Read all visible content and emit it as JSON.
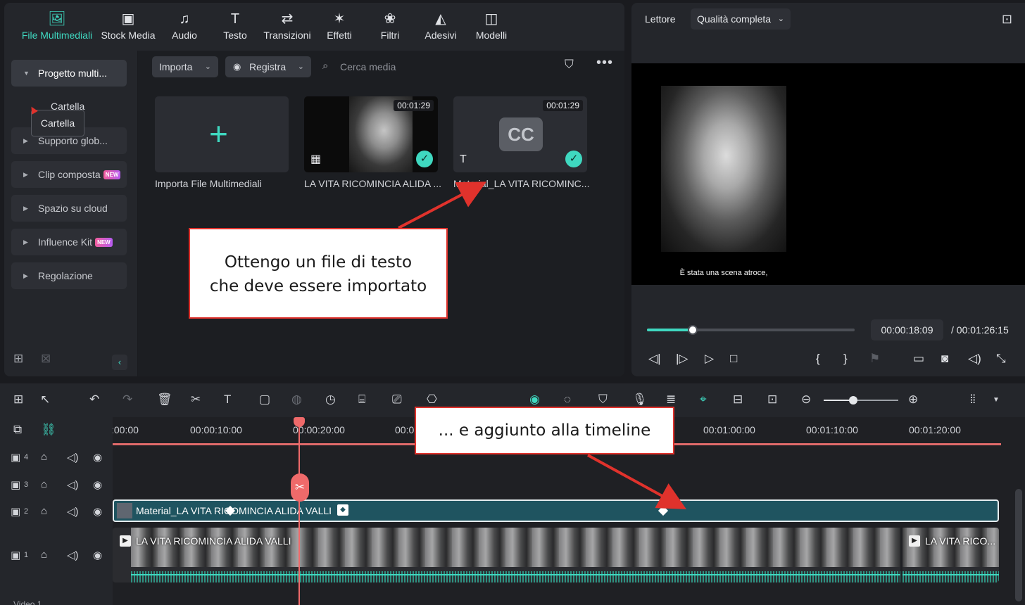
{
  "media_tabs": [
    {
      "label": "File Multimediali",
      "icon": "media-files-icon",
      "active": true
    },
    {
      "label": "Stock Media",
      "icon": "stock-media-icon"
    },
    {
      "label": "Audio",
      "icon": "music-note-icon"
    },
    {
      "label": "Testo",
      "icon": "text-t-icon"
    },
    {
      "label": "Transizioni",
      "icon": "transitions-icon"
    },
    {
      "label": "Effetti",
      "icon": "effects-sparkle-icon"
    },
    {
      "label": "Filtri",
      "icon": "filters-icon"
    },
    {
      "label": "Adesivi",
      "icon": "stickers-icon"
    },
    {
      "label": "Modelli",
      "icon": "templates-icon"
    }
  ],
  "sidebar": {
    "items": [
      {
        "label": "Progetto multi...",
        "open": true
      },
      {
        "label": "Supporto glob..."
      },
      {
        "label": "Clip composta",
        "badge": "NEW"
      },
      {
        "label": "Spazio su cloud"
      },
      {
        "label": "Influence Kit",
        "badge": "NEW"
      },
      {
        "label": "Regolazione"
      }
    ],
    "folder_label": "Cartella",
    "tooltip": "Cartella"
  },
  "media_toolbar": {
    "import_label": "Importa",
    "record_label": "Registra",
    "search_placeholder": "Cerca media"
  },
  "media_items": [
    {
      "caption": "Importa File Multimediali"
    },
    {
      "caption": "LA VITA RICOMINCIA ALIDA ...",
      "duration": "00:01:29"
    },
    {
      "caption": "Material_LA VITA RICOMINC...",
      "duration": "00:01:29",
      "thumb_text": "CC"
    }
  ],
  "preview": {
    "player_label": "Lettore",
    "quality": "Qualità completa",
    "subtitle": "È stata una scena atroce,",
    "current_time": "00:00:18:09",
    "total_time": "/  00:01:26:15",
    "progress_fraction": 0.22
  },
  "timeline": {
    "ruler_labels": [
      ":00:00",
      "00:00:10:00",
      "00:00:20:00",
      "00:0",
      "00:01:00:00",
      "00:01:10:00",
      "00:01:20:00"
    ],
    "tracks": [
      {
        "number": "4"
      },
      {
        "number": "3"
      },
      {
        "number": "2"
      },
      {
        "number": "1"
      }
    ],
    "video_track_label": "Video 1",
    "subtitle_clip": "Material_LA VITA RICOMINCIA ALIDA VALLI",
    "video_clip": "LA VITA RICOMINCIA ALIDA VALLI",
    "video_clip_second": "LA VITA RICO...",
    "zoom_fraction": 0.4
  },
  "annotations": {
    "callout_1_line1": "Ottengo un file di testo",
    "callout_1_line2": "che deve essere importato",
    "callout_2": "... e aggiunto alla timeline",
    "arrow_color": "#e0322c"
  },
  "colors": {
    "accent": "#3fd8c0",
    "playhead": "#ef6a6a",
    "subtitle_clip": "#1f5460"
  }
}
